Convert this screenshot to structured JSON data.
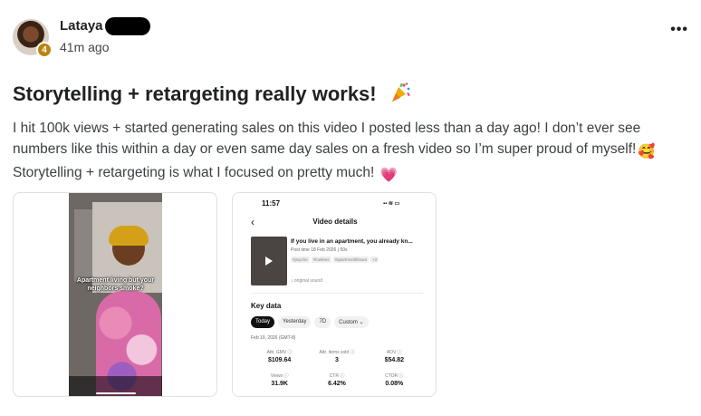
{
  "post": {
    "author": "Lataya",
    "level": "4",
    "time": "41m ago",
    "more_label": "•••",
    "title": "Storytelling + retargeting really works!",
    "title_emoji": "party-popper",
    "body_1": "I hit 100k views + started generating sales on this video I posted less than a day ago! I don’t ever see numbers like this within a day or even same day sales on a fresh video so I’m super proud of myself!",
    "body_emoji_1": "🥰",
    "body_2": "Storytelling + retargeting is what I focused on pretty much!",
    "body_emoji_2": "💗"
  },
  "media": {
    "video": {
      "caption": "Apartment living but your neighbors smoke?"
    },
    "phone": {
      "clock": "11:57",
      "status_icons": "▪▪ ≋ ▭",
      "back_icon": "‹",
      "screen_title": "Video details",
      "video_title": "If you live in an apartment, you already kn...",
      "post_time": "Post time 18 Feb 2026 | 50s",
      "tags": [
        "#psyche",
        "#lowfees",
        "#apartmentlifewat",
        "+2"
      ],
      "original_sound": "♪ original sound",
      "key_data_label": "Key data",
      "chips": [
        {
          "label": "Today",
          "active": true
        },
        {
          "label": "Yesterday",
          "active": false
        },
        {
          "label": "7D",
          "active": false
        },
        {
          "label": "Custom ⌄",
          "active": false
        }
      ],
      "date_label": "Feb 19, 2026 (GMT-8)",
      "metrics": [
        {
          "label": "Attr. GMV ⓘ",
          "value": "$109.64"
        },
        {
          "label": "Attr. items sold ⓘ",
          "value": "3"
        },
        {
          "label": "AOV ⓘ",
          "value": "$54.82"
        },
        {
          "label": "Views ⓘ",
          "value": "31.9K"
        },
        {
          "label": "CTR ⓘ",
          "value": "6.42%"
        },
        {
          "label": "CTOR ⓘ",
          "value": "0.08%"
        }
      ]
    }
  }
}
